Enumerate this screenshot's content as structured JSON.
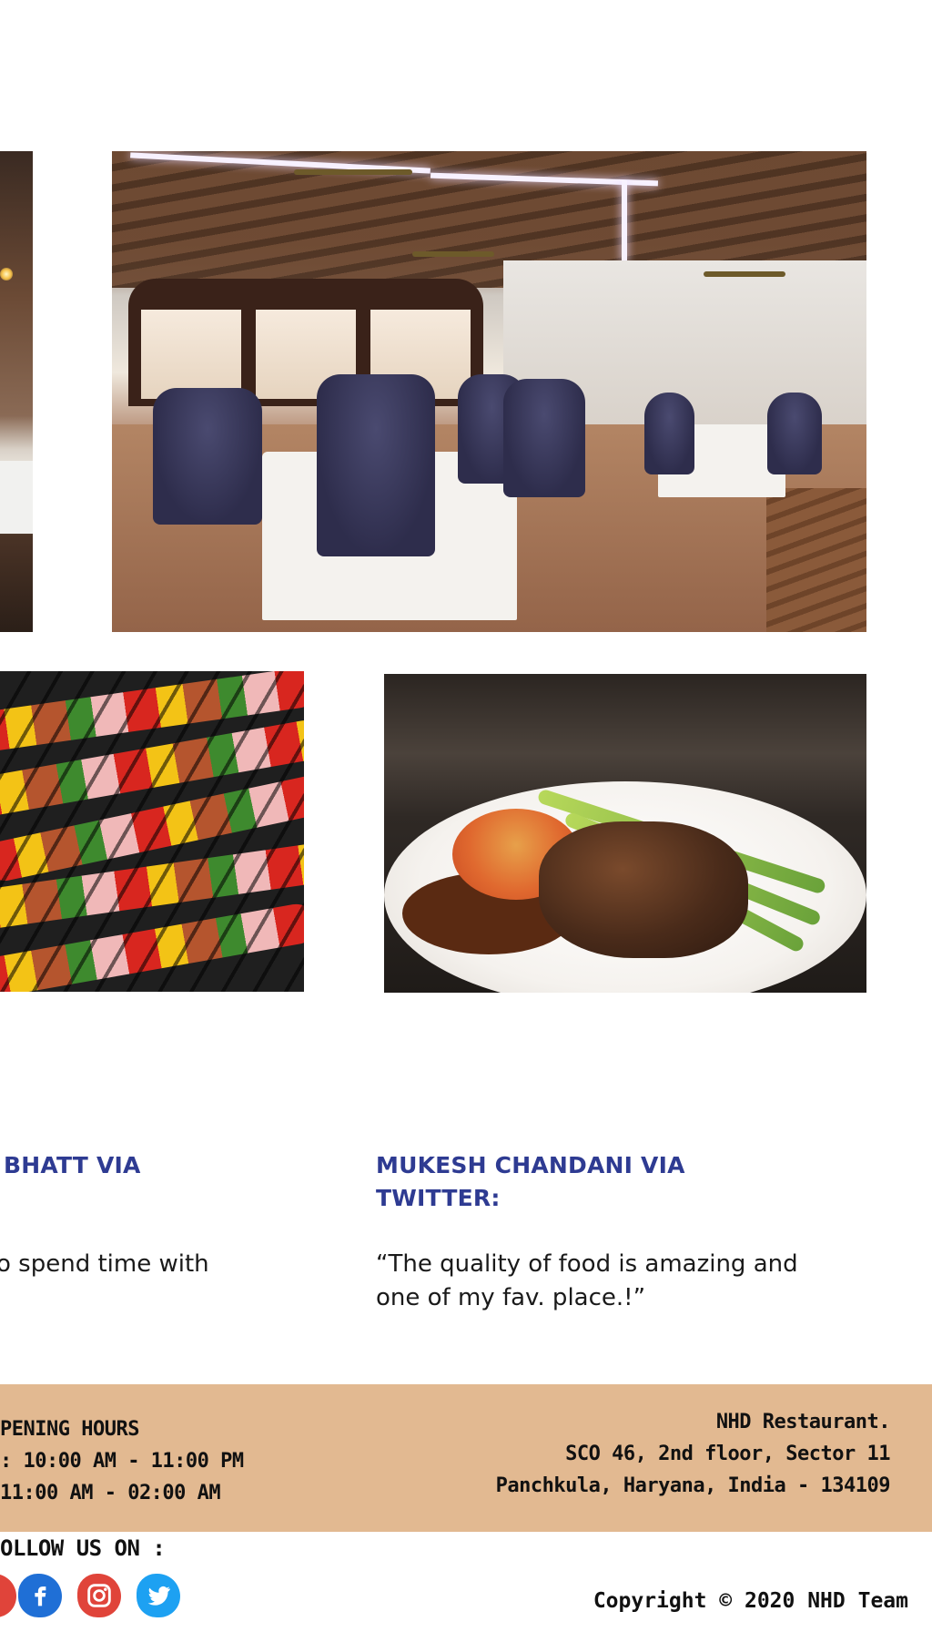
{
  "gallery": {
    "interior_alt": "restaurant dining room",
    "kebab_alt": "grilled vegetable and meat skewers",
    "steak_alt": "steak with sauce and asparagus"
  },
  "testimonials": [
    {
      "name": "BHATT VIA",
      "quote": "o spend time with"
    },
    {
      "name_line1": "MUKESH CHANDANI VIA",
      "name_line2": "TWITTER:",
      "quote_line1": "“The quality of food is amazing and",
      "quote_line2": "one of my fav. place.!”"
    }
  ],
  "footer": {
    "hours_heading": "PENING HOURS",
    "hours_line1": ": 10:00 AM - 11:00 PM",
    "hours_line2": "11:00 AM - 02:00 AM",
    "address_line1": "NHD Restaurant.",
    "address_line2": "SCO 46, 2nd floor, Sector 11",
    "address_line3": "Panchkula, Haryana, India - 134109",
    "follow_label": "OLLOW US ON :",
    "copyright": "Copyright © 2020 NHD Team",
    "colors": {
      "band": "#e2b991",
      "accent": "#2e3b92"
    },
    "social": [
      {
        "icon": "facebook-icon",
        "color": "#1f6fd6"
      },
      {
        "icon": "instagram-icon",
        "color": "#e0443a"
      },
      {
        "icon": "twitter-icon",
        "color": "#1da1f2"
      }
    ]
  }
}
